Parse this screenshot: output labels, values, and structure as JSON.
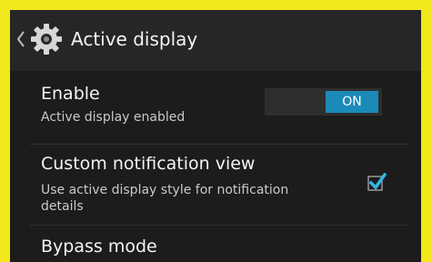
{
  "header": {
    "title": "Active display",
    "up_icon": "chevron-left-icon",
    "app_icon": "gear-icon"
  },
  "settings": [
    {
      "title": "Enable",
      "summary": "Active display enabled",
      "control": "toggle",
      "toggle_label": "ON",
      "checked": true
    },
    {
      "title": "Custom notification view",
      "summary": "Use active display style for notification details",
      "control": "checkbox",
      "checked": true
    },
    {
      "title": "Bypass mode"
    }
  ],
  "colors": {
    "frame": "#f2e71a",
    "background": "#1c1c1c",
    "actionbar": "#262626",
    "accent": "#1b8ab8"
  }
}
